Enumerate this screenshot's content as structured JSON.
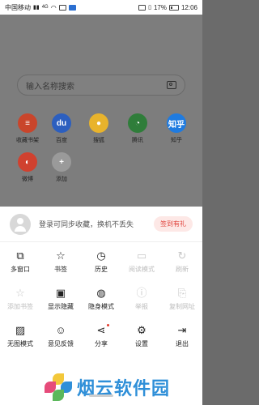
{
  "status": {
    "carrier": "中国移动",
    "signal_text": "4G",
    "battery": "17%",
    "time": "12:06",
    "icons": [
      "signal-icon",
      "wifi-icon",
      "message-icon",
      "notification-icon",
      "hd-icon",
      "vibrate-icon",
      "battery-icon"
    ]
  },
  "search": {
    "placeholder": "输入名称搜索"
  },
  "shortcuts": [
    {
      "label": "收藏书架",
      "glyph": "≡",
      "color": "#c9452b"
    },
    {
      "label": "百度",
      "glyph": "du",
      "color": "#2c5fbf"
    },
    {
      "label": "搜狐",
      "glyph": "●",
      "color": "#e8b32c"
    },
    {
      "label": "腾讯",
      "glyph": "◔",
      "color": "#2f7d3a"
    },
    {
      "label": "知乎",
      "glyph": "知乎",
      "color": "#1f7be0"
    },
    {
      "label": "微博",
      "glyph": "◐",
      "color": "#d0412f"
    },
    {
      "label": "添加",
      "glyph": "+",
      "color": "#9a9a9a"
    }
  ],
  "login": {
    "text": "登录可同步收藏，换机不丢失",
    "button": "签到有礼"
  },
  "menu": [
    {
      "label": "多窗口",
      "glyph": "⧉",
      "icon": "multi-window-icon",
      "enabled": true
    },
    {
      "label": "书签",
      "glyph": "☆",
      "icon": "bookmark-icon",
      "enabled": true
    },
    {
      "label": "历史",
      "glyph": "◷",
      "icon": "history-icon",
      "enabled": true
    },
    {
      "label": "阅读模式",
      "glyph": "▭",
      "icon": "reading-mode-icon",
      "enabled": false
    },
    {
      "label": "刷新",
      "glyph": "↻",
      "icon": "refresh-icon",
      "enabled": false
    },
    {
      "label": "添加书签",
      "glyph": "☆",
      "icon": "add-bookmark-icon",
      "enabled": false
    },
    {
      "label": "显示隐藏",
      "glyph": "▣",
      "icon": "show-hidden-icon",
      "enabled": true
    },
    {
      "label": "隐身模式",
      "glyph": "◍",
      "icon": "incognito-icon",
      "enabled": true
    },
    {
      "label": "举报",
      "glyph": "ⓘ",
      "icon": "report-icon",
      "enabled": false
    },
    {
      "label": "复制网址",
      "glyph": "⎘",
      "icon": "copy-url-icon",
      "enabled": false
    },
    {
      "label": "无图模式",
      "glyph": "▨",
      "icon": "no-image-icon",
      "enabled": true
    },
    {
      "label": "意见反馈",
      "glyph": "☺",
      "icon": "feedback-icon",
      "enabled": true
    },
    {
      "label": "分享",
      "glyph": "⋖",
      "icon": "share-icon",
      "enabled": true
    },
    {
      "label": "设置",
      "glyph": "⚙",
      "icon": "settings-icon",
      "enabled": true
    },
    {
      "label": "退出",
      "glyph": "⇥",
      "icon": "exit-icon",
      "enabled": true
    }
  ],
  "watermark": {
    "text": "烟云软件园"
  }
}
